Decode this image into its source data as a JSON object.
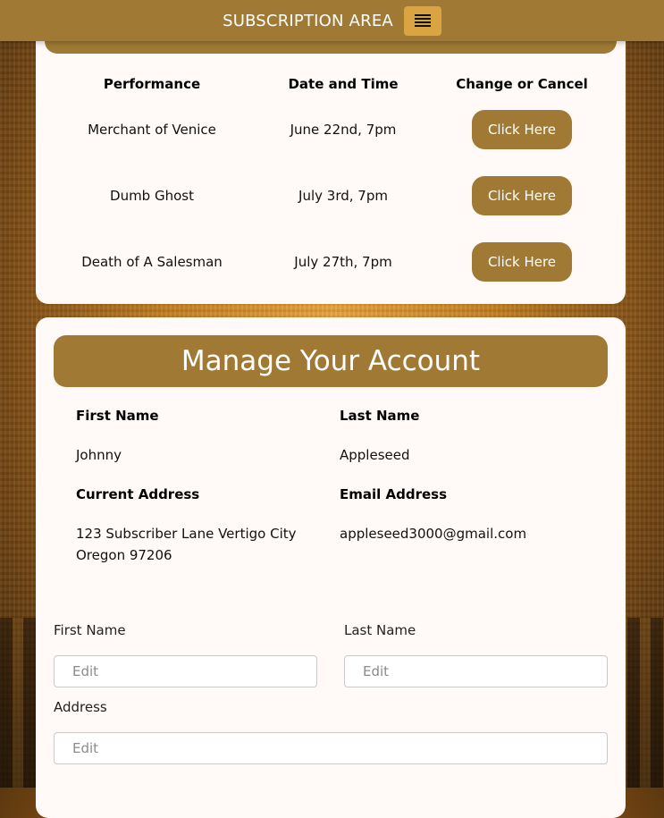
{
  "header": {
    "title": "SUBSCRIPTION AREA",
    "menu_icon": "hamburger-icon"
  },
  "performances": {
    "columns": [
      "Performance",
      "Date and Time",
      "Change or Cancel"
    ],
    "rows": [
      {
        "performance": "Merchant of Venice",
        "date": "June 22nd, 7pm",
        "action": "Click Here"
      },
      {
        "performance": "Dumb Ghost",
        "date": "July 3rd, 7pm",
        "action": "Click Here"
      },
      {
        "performance": "Death of A Salesman",
        "date": "July 27th, 7pm",
        "action": "Click Here"
      }
    ]
  },
  "account": {
    "title": "Manage Your Account",
    "first_name_label": "First Name",
    "first_name": "Johnny",
    "last_name_label": "Last Name",
    "last_name": "Appleseed",
    "address_label": "Current Address",
    "address_line1": "123 Subscriber Lane Vertigo City",
    "address_line2": "Oregon 97206",
    "email_label": "Email Address",
    "email": "appleseed3000@gmail.com"
  },
  "form": {
    "first_name_label": "First Name",
    "first_name_placeholder": "Edit",
    "last_name_label": "Last Name",
    "last_name_placeholder": "Edit",
    "address_label": "Address",
    "address_placeholder": "Edit"
  },
  "colors": {
    "accent": "#a07a34",
    "menu_button": "#d9a441",
    "card": "#fff9f7"
  }
}
